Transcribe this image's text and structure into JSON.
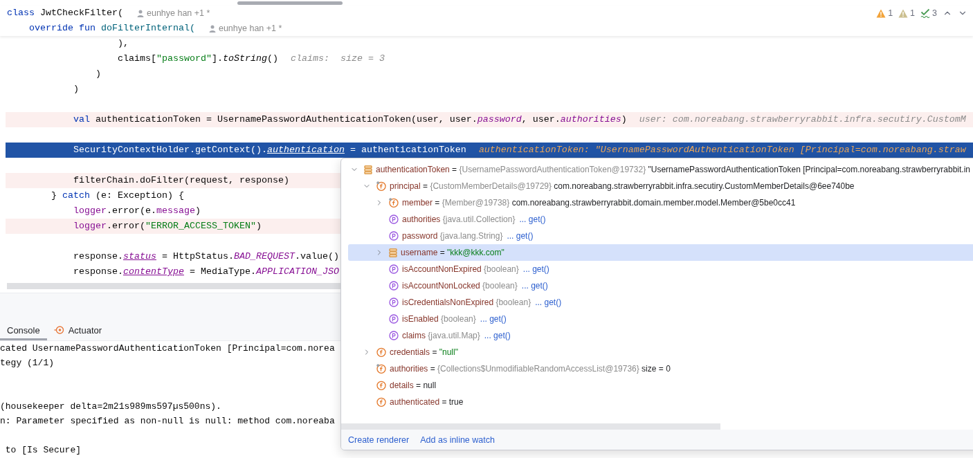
{
  "editor": {
    "sticky_lines": [
      {
        "tokens": [
          {
            "kind": "keyword",
            "text": "class"
          },
          {
            "kind": "plain",
            "text": " JwtCheckFilter("
          }
        ],
        "author": "eunhye han +1 *"
      },
      {
        "tokens": [
          {
            "kind": "keyword",
            "text": "    override fun"
          },
          {
            "kind": "declaration",
            "text": " doFilterInternal("
          }
        ],
        "author": "eunhye han +1 *"
      }
    ],
    "inspections": [
      {
        "kind": "warning",
        "count": "1"
      },
      {
        "kind": "weak-warning",
        "count": "1"
      },
      {
        "kind": "typo",
        "count": "3"
      }
    ],
    "lines": [
      {
        "kind": "plain",
        "tokens": [
          {
            "kind": "plain",
            "text": "                    ),"
          }
        ]
      },
      {
        "kind": "plain",
        "tokens": [
          {
            "kind": "plain",
            "text": "                    claims["
          },
          {
            "kind": "string",
            "text": "\"password\""
          },
          {
            "kind": "plain",
            "text": "]."
          },
          {
            "kind": "italic",
            "text": "toString"
          },
          {
            "kind": "plain",
            "text": "()"
          }
        ],
        "hint": "claims:  size = 3"
      },
      {
        "kind": "plain",
        "tokens": [
          {
            "kind": "plain",
            "text": "                )"
          }
        ]
      },
      {
        "kind": "plain",
        "tokens": [
          {
            "kind": "plain",
            "text": "            )"
          }
        ]
      },
      {
        "kind": "blank"
      },
      {
        "kind": "changed",
        "tokens": [
          {
            "kind": "keyword",
            "text": "            val"
          },
          {
            "kind": "plain",
            "text": " authenticationToken = UsernamePasswordAuthenticationToken(user, user."
          },
          {
            "kind": "constant",
            "text": "password"
          },
          {
            "kind": "plain",
            "text": ", user."
          },
          {
            "kind": "constant",
            "text": "authorities"
          },
          {
            "kind": "plain",
            "text": ")"
          }
        ],
        "hint": "user: com.noreabang.strawberryrabbit.infra.secutiry.CustomM"
      },
      {
        "kind": "blank"
      },
      {
        "kind": "current",
        "tokens": [
          {
            "kind": "plain",
            "text": "            SecurityContextHolder.getContext()."
          },
          {
            "kind": "synthetic",
            "text": "authentication"
          },
          {
            "kind": "plain",
            "text": " = authenticationToken"
          }
        ],
        "hint": "authenticationToken: \"UsernamePasswordAuthenticationToken [Principal=com.noreabang.straw"
      },
      {
        "kind": "blank"
      },
      {
        "kind": "changed",
        "tokens": [
          {
            "kind": "plain",
            "text": "            filterChain.doFilter(request, response)"
          }
        ]
      },
      {
        "kind": "plain",
        "tokens": [
          {
            "kind": "plain",
            "text": "        } "
          },
          {
            "kind": "keyword",
            "text": "catch"
          },
          {
            "kind": "plain",
            "text": " (e: Exception) {"
          }
        ]
      },
      {
        "kind": "plain",
        "tokens": [
          {
            "kind": "field",
            "text": "            logger"
          },
          {
            "kind": "plain",
            "text": ".error(e."
          },
          {
            "kind": "field",
            "text": "message"
          },
          {
            "kind": "plain",
            "text": ")"
          }
        ]
      },
      {
        "kind": "changed",
        "tokens": [
          {
            "kind": "field",
            "text": "            logger"
          },
          {
            "kind": "plain",
            "text": ".error("
          },
          {
            "kind": "string",
            "text": "\"ERROR_ACCESS_TOKEN\""
          },
          {
            "kind": "plain",
            "text": ")"
          }
        ]
      },
      {
        "kind": "blank"
      },
      {
        "kind": "plain",
        "tokens": [
          {
            "kind": "plain",
            "text": "            response."
          },
          {
            "kind": "synthetic",
            "text": "status"
          },
          {
            "kind": "plain",
            "text": " = HttpStatus."
          },
          {
            "kind": "constant",
            "text": "BAD_REQUEST"
          },
          {
            "kind": "plain",
            "text": ".value()"
          }
        ]
      },
      {
        "kind": "plain",
        "tokens": [
          {
            "kind": "plain",
            "text": "            response."
          },
          {
            "kind": "synthetic",
            "text": "contentType"
          },
          {
            "kind": "plain",
            "text": " = MediaType."
          },
          {
            "kind": "constant",
            "text": "APPLICATION_JSO"
          }
        ]
      }
    ]
  },
  "console": {
    "tabs": [
      {
        "label": "Console",
        "kind": "console",
        "selected": true
      },
      {
        "label": "Actuator",
        "kind": "actuator",
        "selected": false
      }
    ],
    "lines": [
      {
        "kind": "text",
        "text": "cated UsernamePasswordAuthenticationToken [Principal=com.norea"
      },
      {
        "kind": "text",
        "text": "tegy (1/1)"
      },
      {
        "kind": "blank"
      },
      {
        "kind": "blank"
      },
      {
        "kind": "text",
        "text": "(housekeeper delta=2m21s989ms597µs500ns)."
      },
      {
        "kind": "text",
        "text": "n: Parameter specified as non-null is null: method com.noreaba"
      },
      {
        "kind": "blank"
      },
      {
        "kind": "text",
        "text": " to [Is Secure]"
      }
    ]
  },
  "debugger_popup": {
    "tree": [
      {
        "kind": "variable",
        "name": "authenticationToken",
        "op": "=",
        "type": "{UsernamePasswordAuthenticationToken@19732}",
        "value": "\"UsernamePasswordAuthenticationToken [Principal=com.noreabang.strawberryrabbit.in",
        "is_string": false,
        "expanded": true,
        "selected": false,
        "children": [
          {
            "kind": "field-marked",
            "name": "principal",
            "op": "=",
            "type": "{CustomMemberDetails@19729}",
            "value": "com.noreabang.strawberryrabbit.infra.secutiry.CustomMemberDetails@6ee740be",
            "is_string": false,
            "expanded": true,
            "selected": false,
            "children": [
              {
                "kind": "field-marked",
                "name": "member",
                "op": "=",
                "type": "{Member@19738}",
                "value": "com.noreabang.strawberryrabbit.domain.member.model.Member@5be0cc41",
                "is_string": false,
                "expanded": false,
                "selected": false
              },
              {
                "kind": "property",
                "name": "authorities",
                "type": "{java.util.Collection}",
                "getter": "... get()",
                "selected": false
              },
              {
                "kind": "property",
                "name": "password",
                "type": "{java.lang.String}",
                "getter": "... get()",
                "selected": false
              },
              {
                "kind": "variable",
                "name": "username",
                "op": "=",
                "value": "\"kkk@kkk.com\"",
                "is_string": true,
                "expanded": false,
                "selected": true
              },
              {
                "kind": "property",
                "name": "isAccountNonExpired",
                "type": "{boolean}",
                "getter": "... get()",
                "selected": false
              },
              {
                "kind": "property",
                "name": "isAccountNonLocked",
                "type": "{boolean}",
                "getter": "... get()",
                "selected": false
              },
              {
                "kind": "property",
                "name": "isCredentialsNonExpired",
                "type": "{boolean}",
                "getter": "... get()",
                "selected": false
              },
              {
                "kind": "property",
                "name": "isEnabled",
                "type": "{boolean}",
                "getter": "... get()",
                "selected": false
              },
              {
                "kind": "property",
                "name": "claims",
                "type": "{java.util.Map}",
                "getter": "... get()",
                "selected": false
              }
            ]
          },
          {
            "kind": "field",
            "name": "credentials",
            "op": "=",
            "value": "\"null\"",
            "is_string": true,
            "expanded": false,
            "selected": false
          },
          {
            "kind": "field-marked",
            "name": "authorities",
            "op": "=",
            "type": "{Collections$UnmodifiableRandomAccessList@19736}",
            "value": "size = 0",
            "is_string": false,
            "selected": false
          },
          {
            "kind": "field",
            "name": "details",
            "op": "=",
            "value": "null",
            "is_string": false,
            "selected": false
          },
          {
            "kind": "field",
            "name": "authenticated",
            "op": "=",
            "value": "true",
            "is_string": false,
            "selected": false
          }
        ]
      }
    ],
    "footer_links": [
      "Create renderer",
      "Add as inline watch"
    ]
  }
}
